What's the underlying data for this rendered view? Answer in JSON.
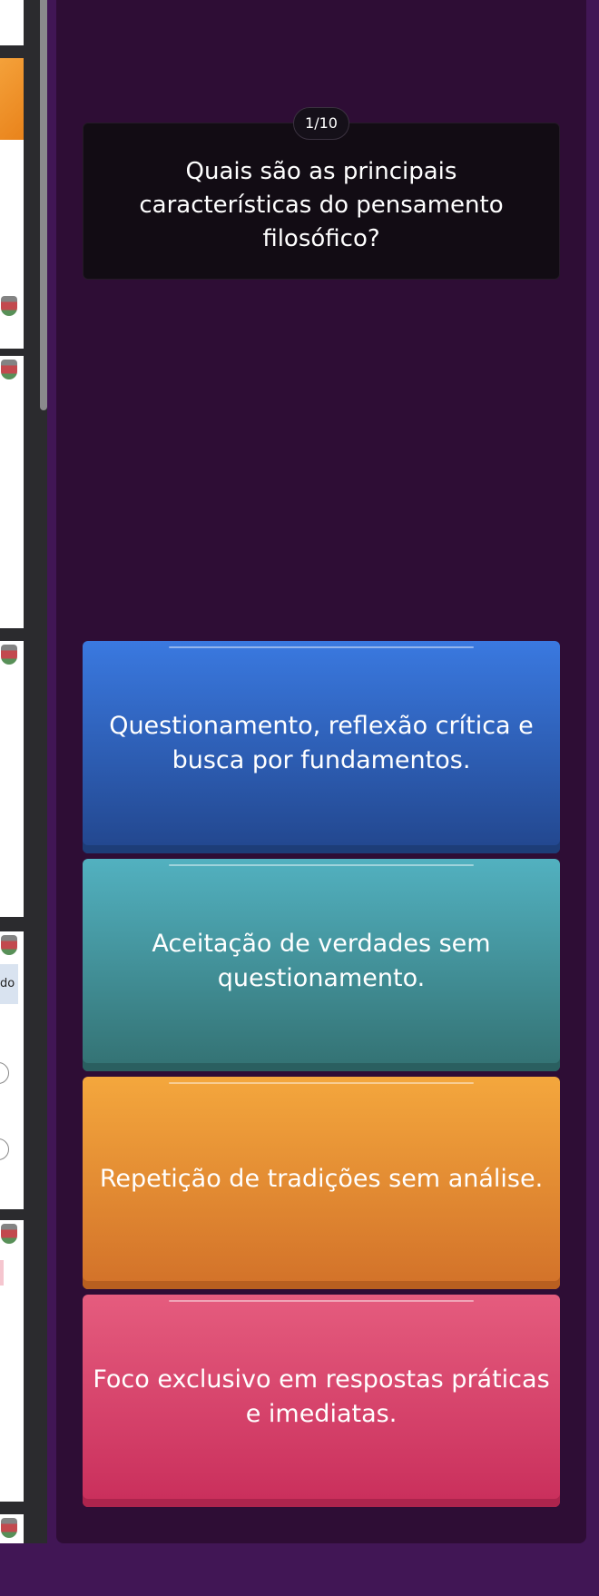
{
  "quiz": {
    "counter": "1/10",
    "question": "Quais são as principais características do pensamento filosófico?",
    "options": [
      {
        "label": "Questionamento, reflexão crítica e busca por fundamentos.",
        "color": "#2f5fbf"
      },
      {
        "label": "Aceitação de verdades sem questionamento.",
        "color": "#42939c"
      },
      {
        "label": "Repetição de tradições sem análise.",
        "color": "#e38c32"
      },
      {
        "label": "Foco exclusivo em respostas práticas e imediatas.",
        "color": "#d8456c"
      }
    ]
  },
  "thumbnails": {
    "partial_text": "do"
  },
  "theme": {
    "page_background": "#411655",
    "panel_background": "#2e0d35",
    "question_background": "#120c14"
  }
}
